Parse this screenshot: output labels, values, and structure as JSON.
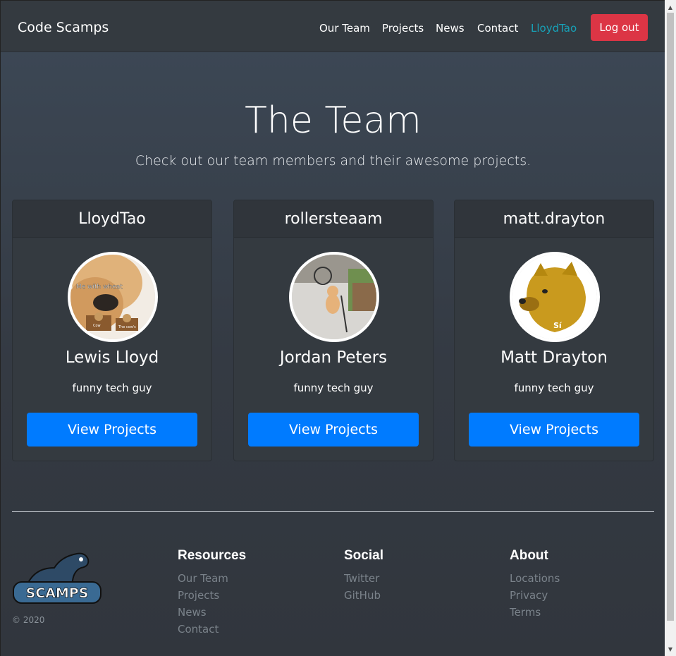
{
  "navbar": {
    "brand": "Code Scamps",
    "links": [
      "Our Team",
      "Projects",
      "News",
      "Contact"
    ],
    "user": "LloydTao",
    "logout_label": "Log out"
  },
  "hero": {
    "title": "The Team",
    "subtitle": "Check out our team members and their awesome projects."
  },
  "members": [
    {
      "username": "LloydTao",
      "name": "Lewis Lloyd",
      "bio": "funny tech guy",
      "button": "View Projects",
      "avatar_caption": "Me with wheat",
      "avatar_small_left": "Cow",
      "avatar_small_right": "The cow's"
    },
    {
      "username": "rollersteaam",
      "name": "Jordan Peters",
      "bio": "funny tech guy",
      "button": "View Projects"
    },
    {
      "username": "matt.drayton",
      "name": "Matt Drayton",
      "bio": "funny tech guy",
      "button": "View Projects",
      "avatar_caption": "Sí"
    }
  ],
  "footer": {
    "logo_text": "SCAMPS",
    "copyright": "© 2020",
    "columns": [
      {
        "heading": "Resources",
        "links": [
          "Our Team",
          "Projects",
          "News",
          "Contact"
        ]
      },
      {
        "heading": "Social",
        "links": [
          "Twitter",
          "GitHub"
        ]
      },
      {
        "heading": "About",
        "links": [
          "Locations",
          "Privacy",
          "Terms"
        ]
      }
    ]
  },
  "colors": {
    "danger": "#dc3545",
    "primary": "#007bff",
    "active_link": "#17a2b8",
    "background": "#343a40"
  }
}
